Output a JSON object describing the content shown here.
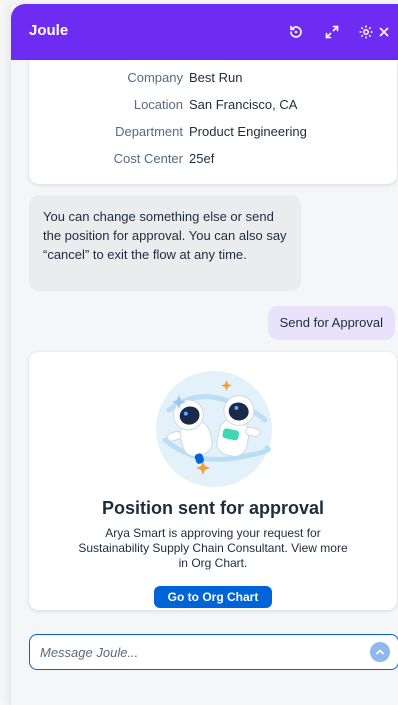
{
  "header": {
    "title": "Joule",
    "actions": [
      {
        "name": "history-icon"
      },
      {
        "name": "expand-icon"
      },
      {
        "name": "settings-icon"
      },
      {
        "name": "close-icon"
      }
    ]
  },
  "details": {
    "rows": [
      {
        "label": "Company",
        "value": "Best Run"
      },
      {
        "label": "Location",
        "value": "San Francisco, CA"
      },
      {
        "label": "Department",
        "value": "Product Engineering"
      },
      {
        "label": "Cost Center",
        "value": "25ef"
      }
    ]
  },
  "messages": {
    "bot": "You can change something else or send the position for approval. You can also say “cancel” to exit the flow at any time.",
    "user": "Send for Approval"
  },
  "success": {
    "title": "Position sent for approval",
    "description": "Arya Smart is approving your request for Sustainability Supply Chain Consultant. View more in Org Chart.",
    "button_label": "Go to Org Chart"
  },
  "composer": {
    "placeholder": "Message Joule..."
  },
  "colors": {
    "header": "#6e2bf2",
    "primary_button": "#0064d9",
    "user_bubble": "#e8e2fb",
    "bot_bubble": "#eaecee"
  }
}
